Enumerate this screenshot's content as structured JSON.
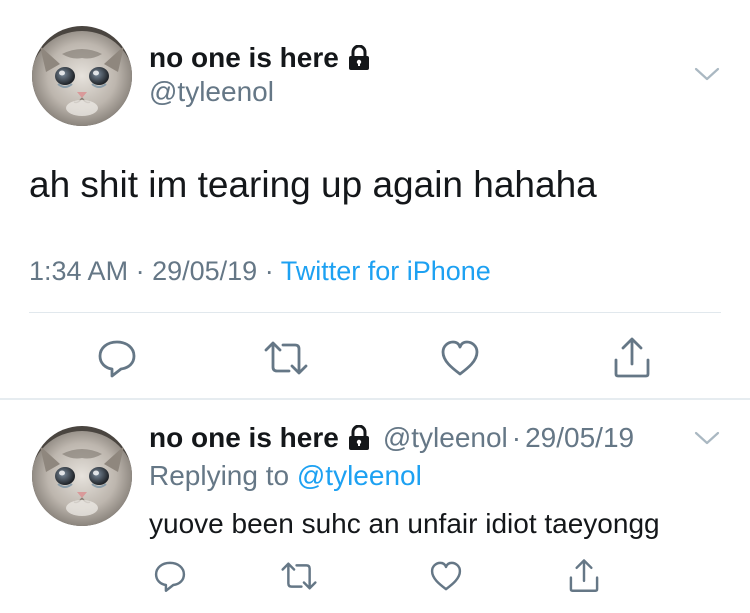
{
  "main_tweet": {
    "display_name": "no one is here",
    "handle": "@tyleenol",
    "text": "ah shit im tearing up again hahaha",
    "time": "1:34 AM",
    "separator": "·",
    "date": "29/05/19",
    "source": "Twitter for iPhone",
    "avatar_icon": "crying-cat-avatar",
    "protected_icon": "lock-icon"
  },
  "reply_tweet": {
    "display_name": "no one is here",
    "handle": "@tyleenol",
    "separator": "·",
    "date": "29/05/19",
    "replying_prefix": "Replying to",
    "replying_to": "@tyleenol",
    "text": "yuove been suhc an unfair idiot taeyongg",
    "avatar_icon": "crying-cat-avatar",
    "protected_icon": "lock-icon"
  },
  "actions": [
    {
      "name": "reply",
      "icon": "reply-bubble-icon"
    },
    {
      "name": "retweet",
      "icon": "retweet-icon"
    },
    {
      "name": "like",
      "icon": "heart-icon"
    },
    {
      "name": "share",
      "icon": "share-icon"
    }
  ],
  "colors": {
    "text_primary": "#14171a",
    "text_secondary": "#657786",
    "link": "#1da1f2",
    "divider": "#e1e8ed",
    "icon": "#657786"
  }
}
